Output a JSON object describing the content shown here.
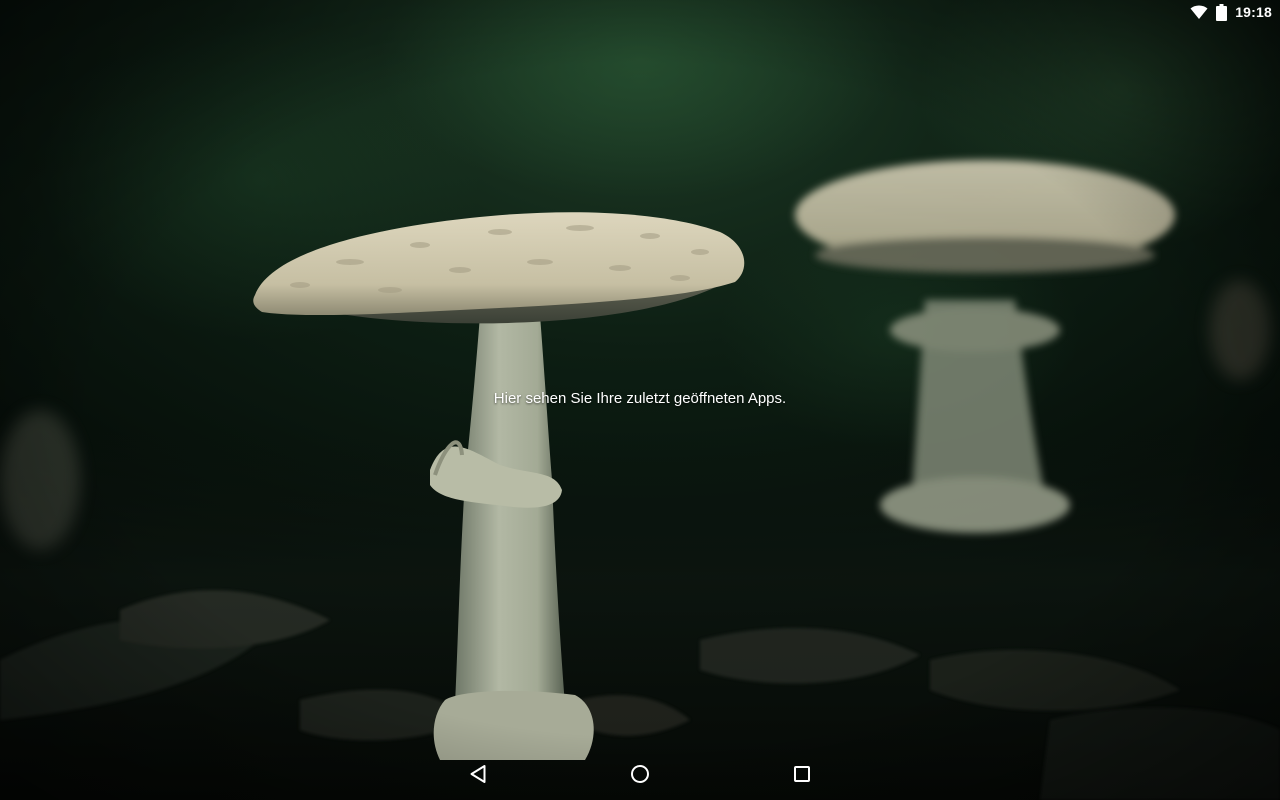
{
  "status_bar": {
    "time": "19:18",
    "icons": [
      "wifi-icon",
      "battery-icon"
    ]
  },
  "recents": {
    "empty_message": "Hier sehen Sie Ihre zuletzt geöffneten Apps."
  },
  "wallpaper": {
    "subject": "mushroom-photo",
    "colors": {
      "background": "#060d08",
      "foliage": "#1f3a26",
      "cap": "#cfc8b0",
      "stem": "#a9b09c"
    }
  },
  "navigation_bar": {
    "buttons": [
      "back-icon",
      "home-icon",
      "recents-icon"
    ],
    "icon_color": "#ffffff"
  }
}
